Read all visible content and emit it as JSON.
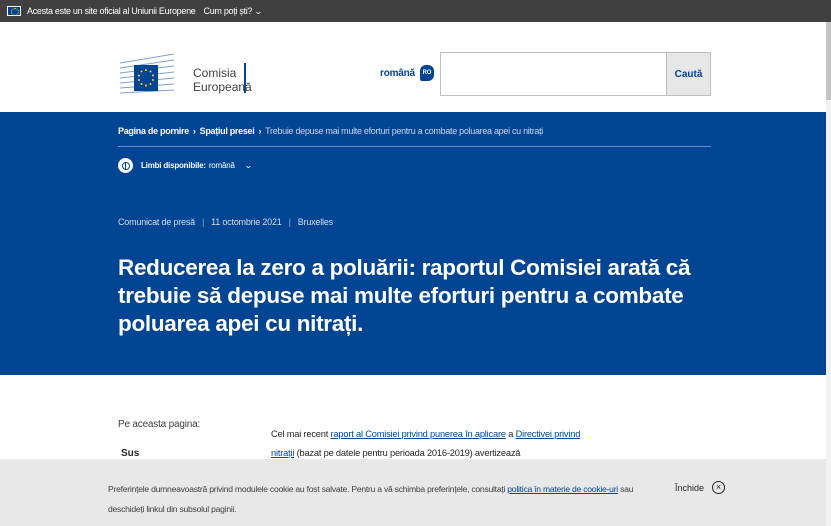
{
  "eu_bar": {
    "official_text": "Acesta este un site oficial al Uniunii Europene",
    "how_text": "Cum poți ști?"
  },
  "header": {
    "logo_line1": "Comisia",
    "logo_line2": "Europeană",
    "language": "română",
    "language_code": "RO",
    "search_placeholder": "",
    "search_button": "Caută"
  },
  "breadcrumb": {
    "items": [
      "Pagina de pornire",
      "Spațiul presei"
    ],
    "current": "Trebuie depuse mai multe eforturi pentru a combate poluarea apei cu nitrați"
  },
  "languages": {
    "label": "Limbi disponibile:",
    "value": "română"
  },
  "meta": {
    "type": "Comunicat de presă",
    "date": "11 octombrie 2021",
    "location": "Bruxelles"
  },
  "headline": "Reducerea la zero a poluării: raportul Comisiei arată că trebuie să depuse mai multe eforturi pentru a combate poluarea apei cu nitrați.",
  "on_page": {
    "label": "Pe aceasta pagina:",
    "link": "Sus"
  },
  "body": {
    "intro": "Cel mai recent ",
    "link1": "raport al Comisiei privind punerea în aplicare",
    "mid": " a ",
    "link2": "Directivei privind nitrații",
    "rest": " (bazat pe datele pentru perioada 2016-2019) avertizează"
  },
  "cookie": {
    "text_before": "Preferințele dumneavoastră privind modulele cookie au fost salvate. Pentru a vă schimba preferințele, consultați ",
    "link": "politica în materie de cookie-uri",
    "text_after": " sau deschideți linkul din subsolul paginii.",
    "close_label": "Închide"
  },
  "colors": {
    "brand_blue": "#004494",
    "top_bar": "#404040",
    "cookie_bg": "#e8e8e8"
  }
}
